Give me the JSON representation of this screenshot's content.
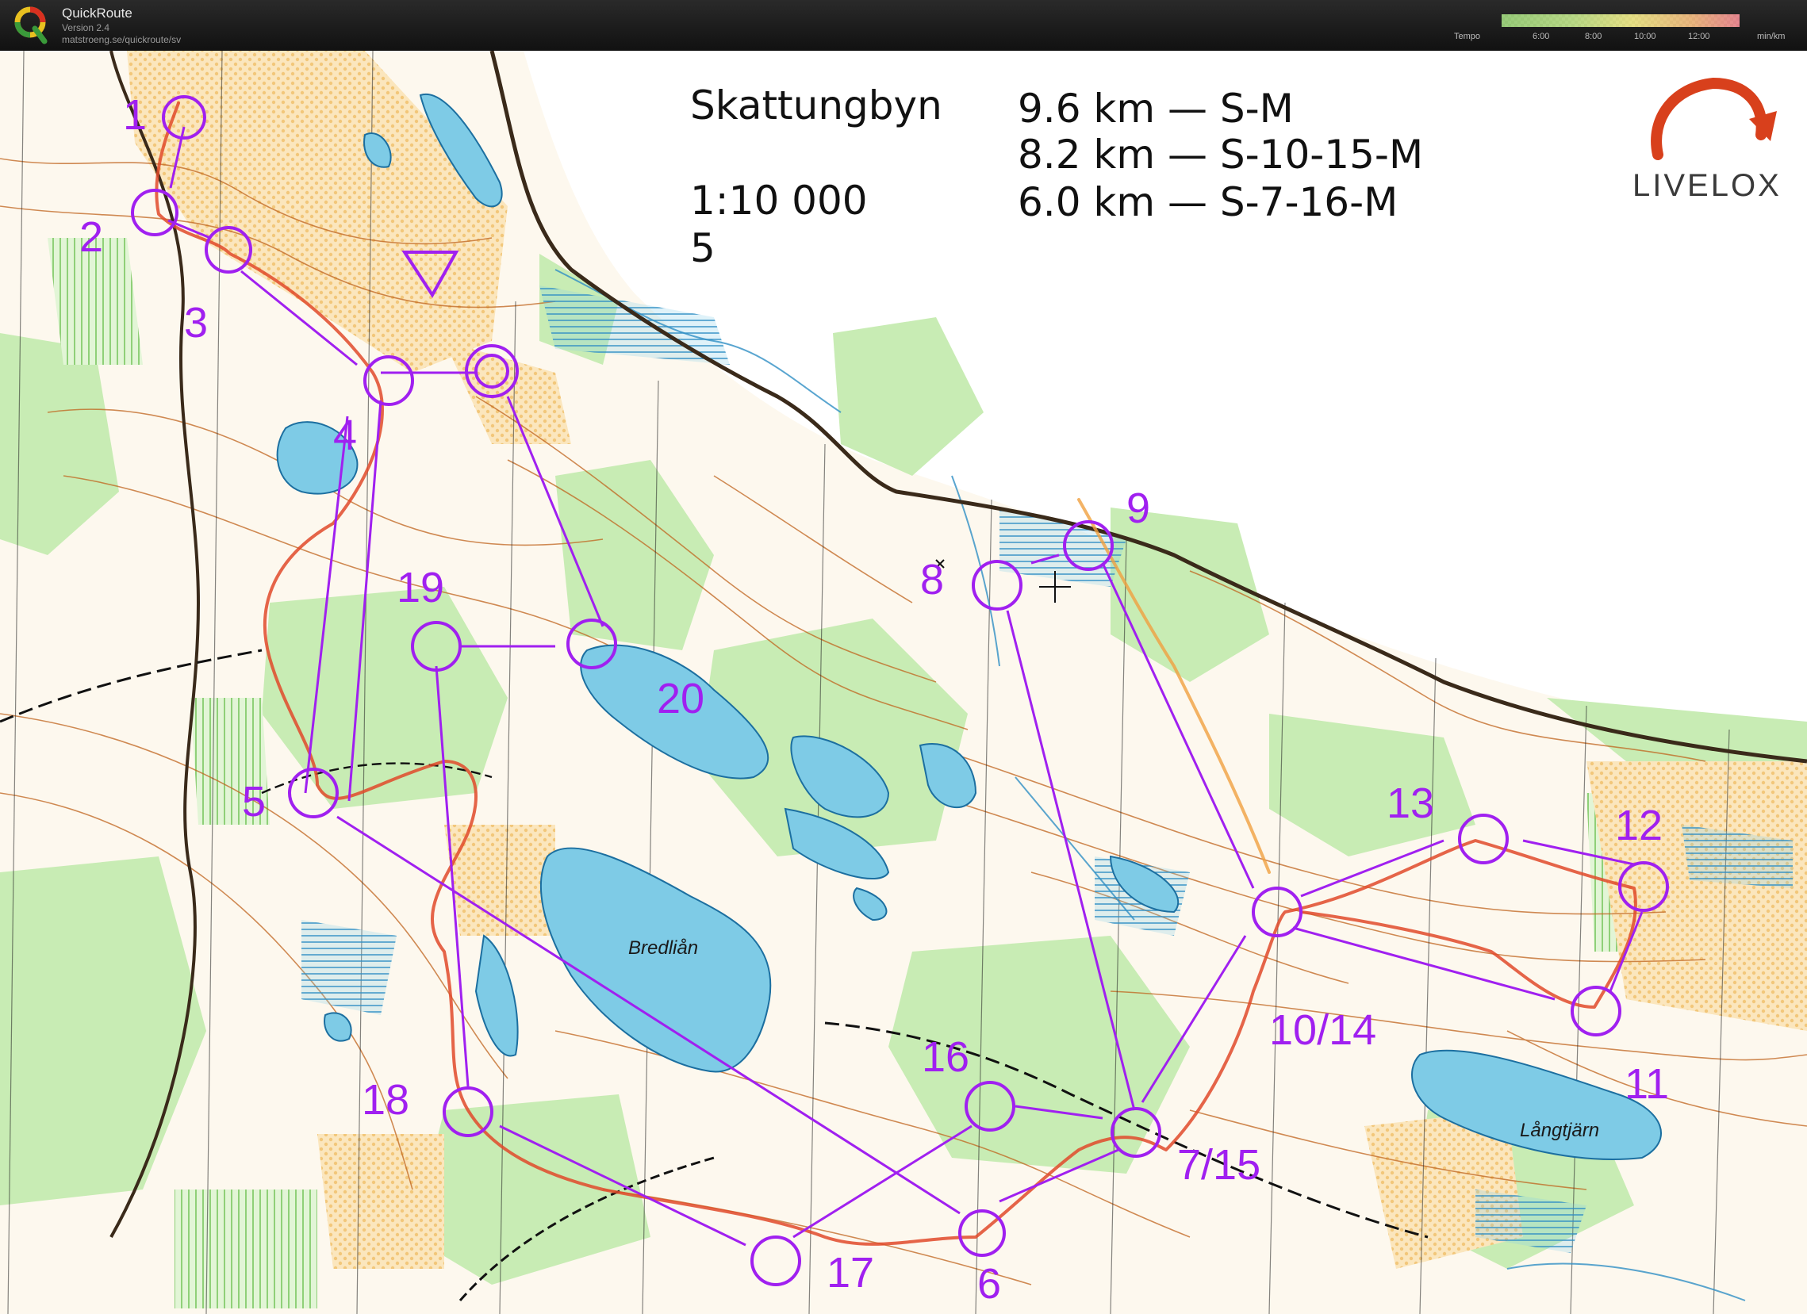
{
  "app": {
    "name": "QuickRoute",
    "version": "Version 2.4",
    "url": "matstroeng.se/quickroute/sv",
    "logo_letter": "Q"
  },
  "tempo": {
    "label": "Tempo",
    "ticks": [
      "6:00",
      "8:00",
      "10:00",
      "12:00"
    ],
    "unit": "min/km"
  },
  "map": {
    "title": "Skattungbyn",
    "scale": "1:10 000",
    "number": "5",
    "courses": [
      "9.6 km — S-M",
      "8.2 km — S-10-15-M",
      "6.0 km — S-7-16-M"
    ],
    "brand": "LIVELOX",
    "lakes": [
      "Bredliån",
      "Långtjärn"
    ],
    "controls": [
      "1",
      "2",
      "3",
      "4",
      "5",
      "6",
      "7/15",
      "8",
      "9",
      "10/14",
      "11",
      "12",
      "13",
      "16",
      "17",
      "18",
      "19",
      "20"
    ]
  },
  "colors": {
    "course": "#a020f0",
    "forest": "#c8ecb4",
    "open": "#f8d9a0",
    "water": "#7ecbe6",
    "contour": "#c0641e"
  }
}
